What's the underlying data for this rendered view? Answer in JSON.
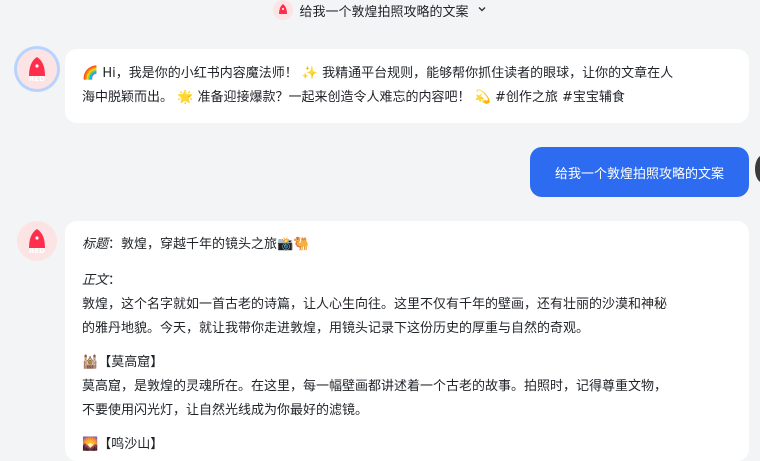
{
  "header": {
    "title": "给我一个敦煌拍照攻略的文案"
  },
  "avatar": {
    "label": "RED"
  },
  "messages": {
    "intro": {
      "emoji_start": "🌈",
      "text_a": " Hi，我是你的小红书内容魔法师！",
      "emoji_sparkles": "✨",
      "text_b": " 我精通平台规则，能够帮你抓住读者的眼球，让你的文章在人",
      "text_c": "海中脱颖而出。",
      "emoji_star": "🌟",
      "text_d": " 准备迎接爆款？一起来创造令人难忘的内容吧！",
      "emoji_dizzy": "💫",
      "text_e": " #创作之旅 #宝宝辅食"
    },
    "user": {
      "text": "给我一个敦煌拍照攻略的文案"
    },
    "reply": {
      "title_label": "标题",
      "title_sep": "：",
      "title_text": "敦煌，穿越千年的镜头之旅",
      "title_emoji": "📸🐫",
      "body_label": "正文",
      "body_sep": "：",
      "body_line1": "敦煌，这个名字就如一首古老的诗篇，让人心生向往。这里不仅有千年的壁画，还有壮丽的沙漠和神秘",
      "body_line2": "的雅丹地貌。今天，就让我带你走进敦煌，用镜头记录下这份历史的厚重与自然的奇观。",
      "s1_emoji": "🕍",
      "s1_heading": "【莫高窟】",
      "s1_line1": "莫高窟，是敦煌的灵魂所在。在这里，每一幅壁画都讲述着一个古老的故事。拍照时，记得尊重文物，",
      "s1_line2": "不要使用闪光灯，让自然光线成为你最好的滤镜。",
      "s2_emoji": "🌄",
      "s2_heading": "【鸣沙山】"
    }
  }
}
